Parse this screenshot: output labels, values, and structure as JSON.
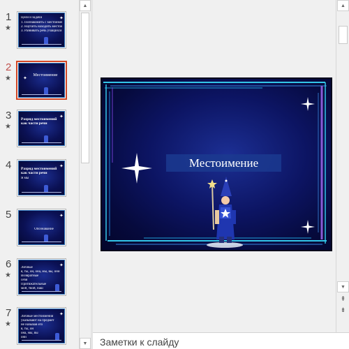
{
  "thumbnails": [
    {
      "number": "1",
      "has_animation": true,
      "star": "★",
      "selected": false,
      "variant": "text",
      "lines": [
        "Цели и задачи",
        "1. Познакомить с местоимением",
        "2. Научить находить местоимения",
        "3. Развивать речь учащихся"
      ]
    },
    {
      "number": "2",
      "has_animation": true,
      "star": "★",
      "selected": true,
      "variant": "title",
      "lines": [
        "Местоимение"
      ]
    },
    {
      "number": "3",
      "has_animation": true,
      "star": "★",
      "selected": false,
      "variant": "heading",
      "lines": [
        "Разряд местоимений",
        "как части речи"
      ]
    },
    {
      "number": "4",
      "has_animation": false,
      "star": "",
      "selected": false,
      "variant": "heading",
      "lines": [
        "Разряд местоимений",
        "как части речи",
        "Я мы"
      ]
    },
    {
      "number": "5",
      "has_animation": false,
      "star": "",
      "selected": false,
      "variant": "center",
      "lines": [
        "Опознавание"
      ]
    },
    {
      "number": "6",
      "has_animation": true,
      "star": "★",
      "selected": false,
      "variant": "list",
      "lines": [
        "Личные",
        "я, ты, он, она, мы, вы, они",
        "Возвратные",
        "себя",
        "Притяжательные",
        "мой, твой, наш"
      ]
    },
    {
      "number": "7",
      "has_animation": true,
      "star": "★",
      "selected": false,
      "variant": "list",
      "lines": [
        "Личные местоимения",
        "указывают на предмет",
        "не называя его",
        "я, ты, он",
        "она, мы, вы",
        "они"
      ]
    }
  ],
  "slide": {
    "title": "Местоимение"
  },
  "scrollbar": {
    "up_arrow": "▲",
    "down_arrow": "▼",
    "prev_slide": "⇞",
    "next_slide": "⇟"
  },
  "notes": {
    "placeholder": "Заметки к слайду"
  },
  "colors": {
    "selection_border": "#d24726",
    "slide_background": "#0c1462",
    "frame_cyan": "#33c6e8",
    "frame_violet": "#8a5ad6"
  }
}
